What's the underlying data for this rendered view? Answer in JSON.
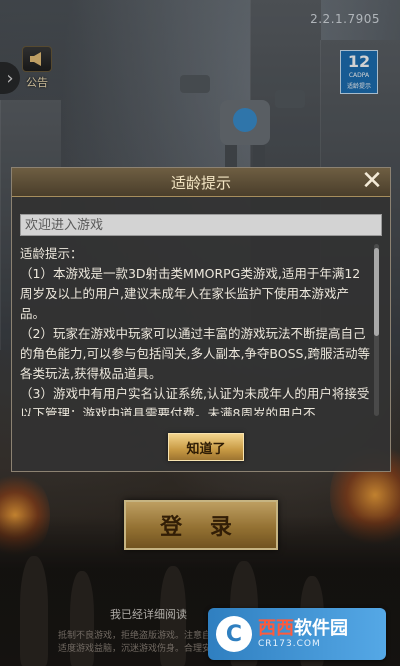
{
  "app": {
    "version": "2.2.1.7905"
  },
  "top": {
    "notice_label": "公告",
    "age_rating": {
      "number": "12",
      "label": "CADPA",
      "sub": "适龄提示"
    }
  },
  "dialog": {
    "title": "适龄提示",
    "close_label": "✕",
    "welcome_text": "欢迎进入游戏",
    "heading": "适龄提示：",
    "paragraphs": [
      "（1）本游戏是一款3D射击类MMORPG类游戏,适用于年满12周岁及以上的用户,建议未成年人在家长监护下使用本游戏产品。",
      "（2）玩家在游戏中玩家可以通过丰富的游戏玩法不断提高自己的角色能力,可以参与包括闯关,多人副本,争夺BOSS,跨服活动等各类玩法,获得极品道具。",
      "（3）游戏中有用户实名认证系统,认证为未成年人的用户将接受以下管理：游戏中道具需要付费。未满8周岁的用户不"
    ],
    "ok_button": "知道了"
  },
  "login": {
    "button_label": "登 录",
    "agree_prefix": "我已经详细阅读",
    "agree_and": "和"
  },
  "footer": {
    "line1": "抵制不良游戏，拒绝盗版游戏。注意自我保护，谨防受骗上当。",
    "line2": "适度游戏益脑，沉迷游戏伤身。合理安排时间，享受健康生活。"
  },
  "watermark": {
    "logo_char": "C",
    "brand_red": "西西",
    "brand_white": "软件园",
    "url": "CR173.COM"
  },
  "colors": {
    "accent_gold": "#c89a44",
    "badge_blue": "#1d6fb4",
    "link_orange": "#e76a2b"
  }
}
